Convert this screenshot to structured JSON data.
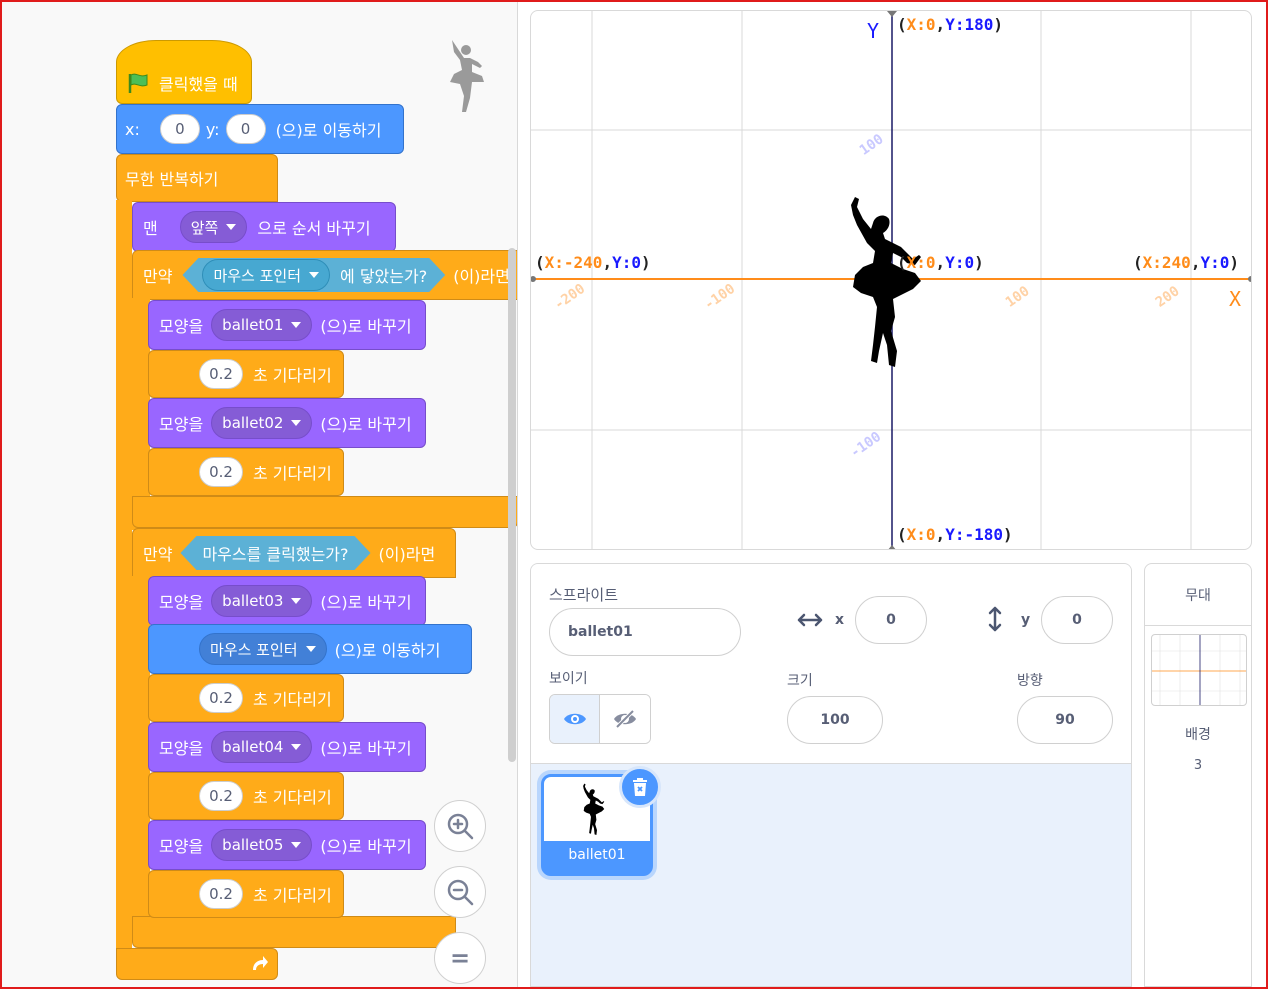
{
  "code": {
    "hat_label": "클릭했을 때",
    "goto": {
      "x_label": "x:",
      "x_value": "0",
      "y_label": "y:",
      "y_value": "0",
      "suffix": "(으)로 이동하기"
    },
    "forever_label": "무한 반복하기",
    "layer": {
      "prefix": "맨",
      "option": "앞쪽",
      "suffix": "으로 순서 바꾸기"
    },
    "if1": {
      "keyword": "만약",
      "sensor_target": "마우스 포인터",
      "sensor_suffix": "에 닿았는가?",
      "tail": "(이)라면"
    },
    "if2": {
      "keyword": "만약",
      "condition": "마우스를 클릭했는가?",
      "tail": "(이)라면"
    },
    "costume_prefix": "모양을",
    "costume_suffix": "(으)로 바꾸기",
    "wait_suffix": "초 기다리기",
    "costumes": [
      "ballet01",
      "ballet02",
      "ballet03",
      "ballet04",
      "ballet05"
    ],
    "wait_value": "0.2",
    "goto_pointer": {
      "target": "마우스 포인터",
      "suffix": "(으)로 이동하기"
    },
    "zoom_in_icon": "zoom-in-icon",
    "zoom_out_icon": "zoom-out-icon",
    "zoom_reset_symbol": "="
  },
  "stage": {
    "y_axis": "Y",
    "x_axis": "X",
    "top": {
      "x": "X:0",
      "sep": ",",
      "y": "Y:180"
    },
    "bottom": {
      "x": "X:0",
      "sep": ",",
      "y": "Y:-180"
    },
    "left": {
      "x": "X:-240",
      "sep": ",",
      "y": "Y:0"
    },
    "right": {
      "x": "X:240",
      "sep": ",",
      "y": "Y:0"
    },
    "center": {
      "x": "X:0",
      "sep": ",",
      "y": "Y:0"
    },
    "ticks_x": [
      "-200",
      "-100",
      "100",
      "200"
    ],
    "ticks_y": [
      "100",
      "-100"
    ],
    "colors": {
      "x_label": "#ff8c1a",
      "y_label": "#1a1aff",
      "axis_x": "#ff8c1a",
      "axis_y": "#1a1a66",
      "tick": "#c9c9ff"
    }
  },
  "sprite_info": {
    "sprite_label": "스프라이트",
    "sprite_name": "ballet01",
    "x_label": "x",
    "x_value": "0",
    "y_label": "y",
    "y_value": "0",
    "show_label": "보이기",
    "size_label": "크기",
    "size_value": "100",
    "direction_label": "방향",
    "direction_value": "90",
    "sprite_tile_name": "ballet01"
  },
  "stage_pane": {
    "title": "무대",
    "backdrop_label": "배경",
    "backdrop_count": "3"
  }
}
